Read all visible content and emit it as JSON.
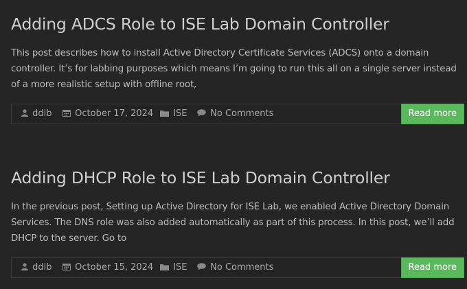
{
  "posts": [
    {
      "title": "Adding ADCS Role to ISE Lab Domain Controller",
      "excerpt": "This post describes how to install Active Directory Certificate Services (ADCS) onto a domain controller. It’s for labbing purposes which means I’m going to run this all on a single server instead of a more realistic setup with offline root,",
      "author": "ddib",
      "date": "October 17, 2024",
      "category": "ISE",
      "comments": "No Comments",
      "read_more": "Read more"
    },
    {
      "title": "Adding DHCP Role to ISE Lab Domain Controller",
      "excerpt": "In the previous post, Setting up Active Directory for ISE Lab, we enabled Active Directory Domain Services. The DNS role was also added automatically as part of this process. In this post, we’ll add DHCP to the server. Go to",
      "author": "ddib",
      "date": "October 15, 2024",
      "category": "ISE",
      "comments": "No Comments",
      "read_more": "Read more"
    }
  ],
  "colors": {
    "background": "#252525",
    "title": "#cfcfcf",
    "text": "#bdbdbd",
    "meta": "#a8a8a8",
    "button": "#5cb85c"
  },
  "icons": {
    "author": "user-icon",
    "date": "calendar-icon",
    "category": "folder-icon",
    "comments": "comment-icon"
  }
}
